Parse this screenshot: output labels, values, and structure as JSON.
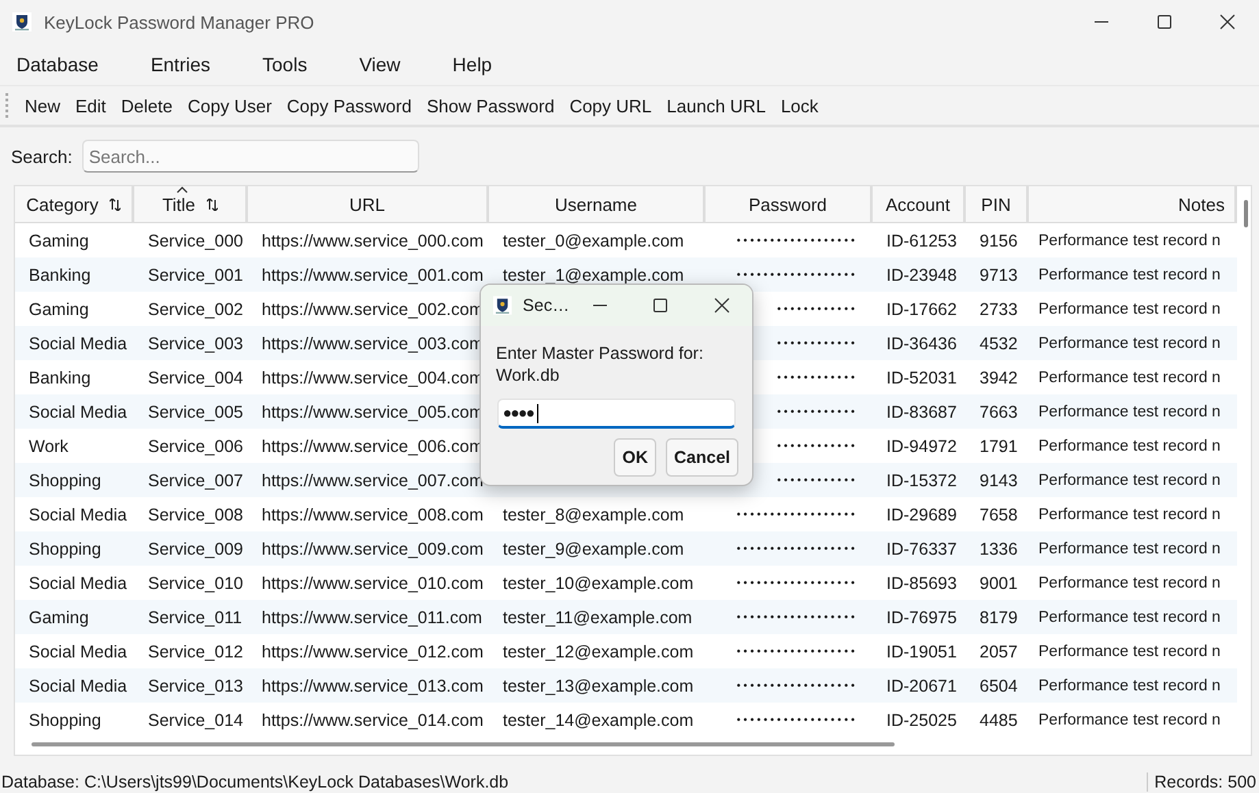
{
  "window": {
    "title": "KeyLock Password Manager PRO"
  },
  "menu": [
    "Database",
    "Entries",
    "Tools",
    "View",
    "Help"
  ],
  "toolbar": [
    "New",
    "Edit",
    "Delete",
    "Copy User",
    "Copy Password",
    "Show Password",
    "Copy URL",
    "Launch URL",
    "Lock"
  ],
  "search": {
    "label": "Search:",
    "placeholder": "Search..."
  },
  "table": {
    "columns": [
      {
        "label": "Category",
        "sortable": true,
        "sorted": false
      },
      {
        "label": "Title",
        "sortable": true,
        "sorted": true
      },
      {
        "label": "URL",
        "sortable": false,
        "sorted": false
      },
      {
        "label": "Username",
        "sortable": false,
        "sorted": false
      },
      {
        "label": "Password",
        "sortable": false,
        "sorted": false
      },
      {
        "label": "Account",
        "sortable": false,
        "sorted": false
      },
      {
        "label": "PIN",
        "sortable": false,
        "sorted": false
      },
      {
        "label": "Notes",
        "sortable": false,
        "sorted": false
      }
    ],
    "rows": [
      {
        "category": "Gaming",
        "title": "Service_000",
        "url": "https://www.service_000.com",
        "username": "tester_0@example.com",
        "password": "••••••••••••••••••",
        "account": "ID-61253",
        "pin": "9156",
        "notes": "Performance test record n"
      },
      {
        "category": "Banking",
        "title": "Service_001",
        "url": "https://www.service_001.com",
        "username": "tester_1@example.com",
        "password": "••••••••••••••••••",
        "account": "ID-23948",
        "pin": "9713",
        "notes": "Performance test record n"
      },
      {
        "category": "Gaming",
        "title": "Service_002",
        "url": "https://www.service_002.com",
        "password": "••••••••••••",
        "account": "ID-17662",
        "pin": "2733",
        "notes": "Performance test record n"
      },
      {
        "category": "Social Media",
        "title": "Service_003",
        "url": "https://www.service_003.com",
        "password": "••••••••••••",
        "account": "ID-36436",
        "pin": "4532",
        "notes": "Performance test record n"
      },
      {
        "category": "Banking",
        "title": "Service_004",
        "url": "https://www.service_004.com",
        "password": "••••••••••••",
        "account": "ID-52031",
        "pin": "3942",
        "notes": "Performance test record n"
      },
      {
        "category": "Social Media",
        "title": "Service_005",
        "url": "https://www.service_005.com",
        "password": "••••••••••••",
        "account": "ID-83687",
        "pin": "7663",
        "notes": "Performance test record n"
      },
      {
        "category": "Work",
        "title": "Service_006",
        "url": "https://www.service_006.com",
        "password": "••••••••••••",
        "account": "ID-94972",
        "pin": "1791",
        "notes": "Performance test record n"
      },
      {
        "category": "Shopping",
        "title": "Service_007",
        "url": "https://www.service_007.com",
        "password": "••••••••••••",
        "account": "ID-15372",
        "pin": "9143",
        "notes": "Performance test record n"
      },
      {
        "category": "Social Media",
        "title": "Service_008",
        "url": "https://www.service_008.com",
        "username": "tester_8@example.com",
        "password": "••••••••••••••••••",
        "account": "ID-29689",
        "pin": "7658",
        "notes": "Performance test record n"
      },
      {
        "category": "Shopping",
        "title": "Service_009",
        "url": "https://www.service_009.com",
        "username": "tester_9@example.com",
        "password": "••••••••••••••••••",
        "account": "ID-76337",
        "pin": "1336",
        "notes": "Performance test record n"
      },
      {
        "category": "Social Media",
        "title": "Service_010",
        "url": "https://www.service_010.com",
        "username": "tester_10@example.com",
        "password": "••••••••••••••••••",
        "account": "ID-85693",
        "pin": "9001",
        "notes": "Performance test record n"
      },
      {
        "category": "Gaming",
        "title": "Service_011",
        "url": "https://www.service_011.com",
        "username": "tester_11@example.com",
        "password": "••••••••••••••••••",
        "account": "ID-76975",
        "pin": "8179",
        "notes": "Performance test record n"
      },
      {
        "category": "Social Media",
        "title": "Service_012",
        "url": "https://www.service_012.com",
        "username": "tester_12@example.com",
        "password": "••••••••••••••••••",
        "account": "ID-19051",
        "pin": "2057",
        "notes": "Performance test record n"
      },
      {
        "category": "Social Media",
        "title": "Service_013",
        "url": "https://www.service_013.com",
        "username": "tester_13@example.com",
        "password": "••••••••••••••••••",
        "account": "ID-20671",
        "pin": "6504",
        "notes": "Performance test record n"
      },
      {
        "category": "Shopping",
        "title": "Service_014",
        "url": "https://www.service_014.com",
        "username": "tester_14@example.com",
        "password": "••••••••••••••••••",
        "account": "ID-25025",
        "pin": "4485",
        "notes": "Performance test record n"
      }
    ]
  },
  "dialog": {
    "title": "Sec…",
    "message": "Enter Master Password for:\nWork.db",
    "value": "●●●●",
    "buttons": [
      "OK",
      "Cancel"
    ]
  },
  "status_bar": {
    "path": "Database: C:\\Users\\jts99\\Documents\\KeyLock Databases\\Work.db",
    "records": "Records: 500"
  }
}
